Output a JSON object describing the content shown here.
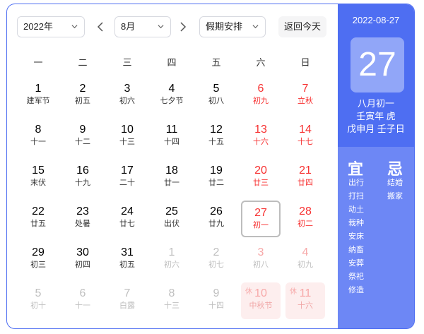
{
  "toolbar": {
    "year": "2022年",
    "month": "8月",
    "holiday_select": "假期安排",
    "today_button": "返回今天"
  },
  "weekdays": [
    "一",
    "二",
    "三",
    "四",
    "五",
    "六",
    "日"
  ],
  "days": [
    {
      "num": "1",
      "lunar": "建军节",
      "type": "normal"
    },
    {
      "num": "2",
      "lunar": "初五",
      "type": "normal"
    },
    {
      "num": "3",
      "lunar": "初六",
      "type": "normal"
    },
    {
      "num": "4",
      "lunar": "七夕节",
      "type": "normal"
    },
    {
      "num": "5",
      "lunar": "初八",
      "type": "normal"
    },
    {
      "num": "6",
      "lunar": "初九",
      "type": "weekend"
    },
    {
      "num": "7",
      "lunar": "立秋",
      "type": "weekend"
    },
    {
      "num": "8",
      "lunar": "十一",
      "type": "normal"
    },
    {
      "num": "9",
      "lunar": "十二",
      "type": "normal"
    },
    {
      "num": "10",
      "lunar": "十三",
      "type": "normal"
    },
    {
      "num": "11",
      "lunar": "十四",
      "type": "normal"
    },
    {
      "num": "12",
      "lunar": "十五",
      "type": "normal"
    },
    {
      "num": "13",
      "lunar": "十六",
      "type": "weekend"
    },
    {
      "num": "14",
      "lunar": "十七",
      "type": "weekend"
    },
    {
      "num": "15",
      "lunar": "末伏",
      "type": "normal"
    },
    {
      "num": "16",
      "lunar": "十九",
      "type": "normal"
    },
    {
      "num": "17",
      "lunar": "二十",
      "type": "normal"
    },
    {
      "num": "18",
      "lunar": "廿一",
      "type": "normal"
    },
    {
      "num": "19",
      "lunar": "廿二",
      "type": "normal"
    },
    {
      "num": "20",
      "lunar": "廿三",
      "type": "weekend"
    },
    {
      "num": "21",
      "lunar": "廿四",
      "type": "weekend"
    },
    {
      "num": "22",
      "lunar": "廿五",
      "type": "normal"
    },
    {
      "num": "23",
      "lunar": "处暑",
      "type": "normal"
    },
    {
      "num": "24",
      "lunar": "廿七",
      "type": "normal"
    },
    {
      "num": "25",
      "lunar": "出伏",
      "type": "normal"
    },
    {
      "num": "26",
      "lunar": "廿九",
      "type": "normal"
    },
    {
      "num": "27",
      "lunar": "初一",
      "type": "weekend",
      "today": true
    },
    {
      "num": "28",
      "lunar": "初二",
      "type": "weekend"
    },
    {
      "num": "29",
      "lunar": "初三",
      "type": "normal"
    },
    {
      "num": "30",
      "lunar": "初四",
      "type": "normal"
    },
    {
      "num": "31",
      "lunar": "初五",
      "type": "normal"
    },
    {
      "num": "1",
      "lunar": "初六",
      "type": "other"
    },
    {
      "num": "2",
      "lunar": "初七",
      "type": "other"
    },
    {
      "num": "3",
      "lunar": "初八",
      "type": "other-weekend"
    },
    {
      "num": "4",
      "lunar": "初九",
      "type": "other-weekend"
    },
    {
      "num": "5",
      "lunar": "初十",
      "type": "other"
    },
    {
      "num": "6",
      "lunar": "十一",
      "type": "other"
    },
    {
      "num": "7",
      "lunar": "白露",
      "type": "other"
    },
    {
      "num": "8",
      "lunar": "十三",
      "type": "other"
    },
    {
      "num": "9",
      "lunar": "十四",
      "type": "other"
    },
    {
      "num": "10",
      "lunar": "中秋节",
      "type": "holiday",
      "rest": "休"
    },
    {
      "num": "11",
      "lunar": "十六",
      "type": "holiday",
      "rest": "休"
    }
  ],
  "panel": {
    "date": "2022-08-27",
    "big_day": "27",
    "lunar_month_day": "八月初一",
    "year_ganzhi": "壬寅年 虎",
    "month_day_ganzhi": "戊申月 壬子日",
    "yi_title": "宜",
    "ji_title": "忌",
    "yi": [
      "出行",
      "打扫",
      "动土",
      "栽种",
      "安床",
      "纳畜",
      "安葬",
      "祭祀",
      "修造"
    ],
    "ji": [
      "结婚",
      "搬家"
    ]
  },
  "colors": {
    "accent": "#4e6ef2",
    "weekend_red": "#f73131",
    "holiday_bg": "#fdeeee"
  }
}
